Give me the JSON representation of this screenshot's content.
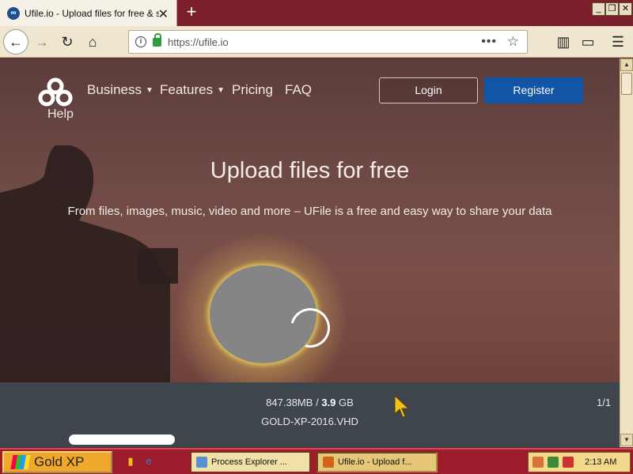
{
  "browser": {
    "tab_title": "Ufile.io - Upload files for free & sh",
    "url": "https://ufile.io",
    "new_tab_symbol": "+"
  },
  "site": {
    "nav": {
      "business": "Business",
      "features": "Features",
      "pricing": "Pricing",
      "faq": "FAQ",
      "help": "Help"
    },
    "login_label": "Login",
    "register_label": "Register",
    "hero_title": "Upload files for free",
    "hero_subtitle": "From files, images, music, video and more – UFile is a free and easy way to share your data",
    "upload": {
      "uploaded": "847.38MB",
      "separator": "/",
      "total": "3.9",
      "total_unit": "GB",
      "filename": "GOLD-XP-2016.VHD",
      "count": "1/1",
      "progress_fraction": 0.217
    }
  },
  "taskbar": {
    "start_label": "Gold XP",
    "tasks": [
      {
        "label": "Process Explorer ..."
      },
      {
        "label": "Ufile.io - Upload f..."
      }
    ],
    "clock": "2:13 AM"
  },
  "colors": {
    "register_button": "#1254a6",
    "upload_bar": "#3f454d",
    "taskbar": "#9c1c2b"
  }
}
